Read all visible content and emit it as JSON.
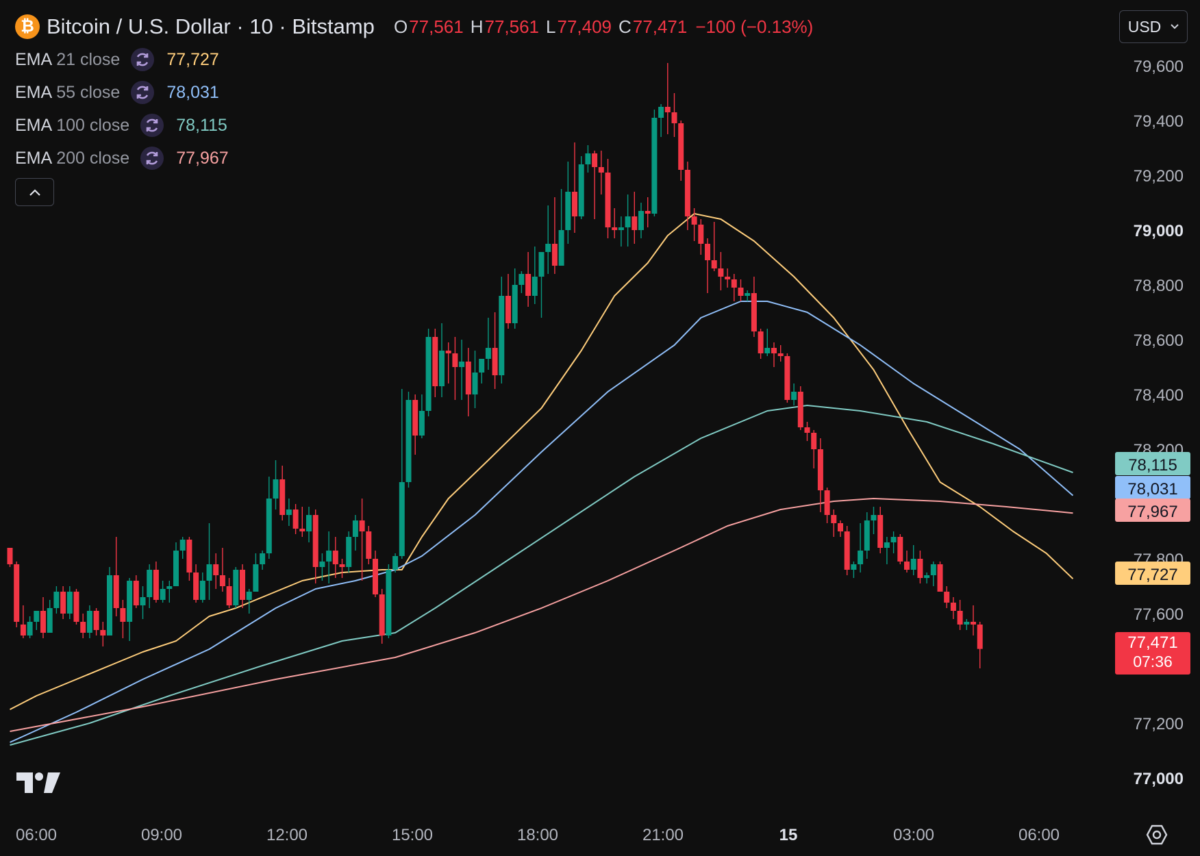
{
  "header": {
    "symbol_icon": "bitcoin-icon",
    "symbol_glyph": "₿",
    "title": "Bitcoin / U.S. Dollar · 10 · Bitstamp",
    "o_label": "O",
    "o_value": "77,561",
    "h_label": "H",
    "h_value": "77,561",
    "l_label": "L",
    "l_value": "77,409",
    "c_label": "C",
    "c_value": "77,471",
    "change": "−100 (−0.13%)",
    "currency": "USD"
  },
  "indicators": [
    {
      "name": "EMA",
      "params": "21 close",
      "value": "77,727",
      "color": "#ffce7c"
    },
    {
      "name": "EMA",
      "params": "55 close",
      "value": "78,031",
      "color": "#90bff9"
    },
    {
      "name": "EMA",
      "params": "100 close",
      "value": "78,115",
      "color": "#80cbc4"
    },
    {
      "name": "EMA",
      "params": "200 close",
      "value": "77,967",
      "color": "#f7a1a1"
    }
  ],
  "colors": {
    "up": "#089981",
    "down": "#f23645",
    "background": "#0f0f0f",
    "text": "#d1d4dc"
  },
  "chart_data": {
    "type": "candlestick",
    "ylim": [
      76940,
      79700
    ],
    "y_ticks": [
      {
        "v": 79600,
        "label": "79,600",
        "bold": false
      },
      {
        "v": 79400,
        "label": "79,400",
        "bold": false
      },
      {
        "v": 79200,
        "label": "79,200",
        "bold": false
      },
      {
        "v": 79000,
        "label": "79,000",
        "bold": true
      },
      {
        "v": 78800,
        "label": "78,800",
        "bold": false
      },
      {
        "v": 78600,
        "label": "78,600",
        "bold": false
      },
      {
        "v": 78400,
        "label": "78,400",
        "bold": false
      },
      {
        "v": 78200,
        "label": "78,200",
        "bold": false
      },
      {
        "v": 77800,
        "label": "77,800",
        "bold": false
      },
      {
        "v": 77600,
        "label": "77,600",
        "bold": false
      },
      {
        "v": 77200,
        "label": "77,200",
        "bold": false
      },
      {
        "v": 77000,
        "label": "77,000",
        "bold": true
      }
    ],
    "x_ticks": [
      {
        "label": "06:00",
        "bold": false
      },
      {
        "label": "09:00",
        "bold": false
      },
      {
        "label": "12:00",
        "bold": false
      },
      {
        "label": "15:00",
        "bold": false
      },
      {
        "label": "18:00",
        "bold": false
      },
      {
        "label": "21:00",
        "bold": false
      },
      {
        "label": "15",
        "bold": true
      },
      {
        "label": "03:00",
        "bold": false
      },
      {
        "label": "06:00",
        "bold": false
      }
    ],
    "candles": [
      [
        77840,
        77840,
        77770,
        77780
      ],
      [
        77780,
        77790,
        77550,
        77570
      ],
      [
        77560,
        77630,
        77510,
        77520
      ],
      [
        77520,
        77590,
        77510,
        77570
      ],
      [
        77570,
        77610,
        77540,
        77610
      ],
      [
        77610,
        77660,
        77510,
        77530
      ],
      [
        77530,
        77650,
        77530,
        77620
      ],
      [
        77620,
        77700,
        77600,
        77680
      ],
      [
        77680,
        77700,
        77580,
        77600
      ],
      [
        77600,
        77700,
        77580,
        77680
      ],
      [
        77680,
        77690,
        77560,
        77570
      ],
      [
        77570,
        77600,
        77510,
        77530
      ],
      [
        77530,
        77630,
        77510,
        77610
      ],
      [
        77610,
        77620,
        77520,
        77540
      ],
      [
        77540,
        77570,
        77480,
        77520
      ],
      [
        77520,
        77770,
        77520,
        77740
      ],
      [
        77740,
        77880,
        77590,
        77620
      ],
      [
        77620,
        77650,
        77510,
        77570
      ],
      [
        77570,
        77730,
        77500,
        77720
      ],
      [
        77720,
        77740,
        77620,
        77630
      ],
      [
        77630,
        77700,
        77580,
        77660
      ],
      [
        77660,
        77780,
        77620,
        77760
      ],
      [
        77760,
        77790,
        77640,
        77650
      ],
      [
        77650,
        77720,
        77640,
        77690
      ],
      [
        77690,
        77720,
        77640,
        77700
      ],
      [
        77700,
        77860,
        77700,
        77830
      ],
      [
        77830,
        77880,
        77800,
        77870
      ],
      [
        77870,
        77880,
        77720,
        77750
      ],
      [
        77750,
        77780,
        77640,
        77650
      ],
      [
        77650,
        77750,
        77640,
        77720
      ],
      [
        77720,
        77930,
        77650,
        77780
      ],
      [
        77780,
        77820,
        77690,
        77740
      ],
      [
        77740,
        77840,
        77680,
        77700
      ],
      [
        77700,
        77730,
        77620,
        77630
      ],
      [
        77630,
        77770,
        77620,
        77760
      ],
      [
        77760,
        77780,
        77620,
        77650
      ],
      [
        77650,
        77690,
        77600,
        77680
      ],
      [
        77680,
        77820,
        77680,
        77780
      ],
      [
        77780,
        77830,
        77760,
        77820
      ],
      [
        77820,
        78100,
        77800,
        78020
      ],
      [
        78020,
        78160,
        77980,
        78090
      ],
      [
        78090,
        78140,
        77940,
        77960
      ],
      [
        77960,
        78020,
        77920,
        77980
      ],
      [
        77980,
        78000,
        77890,
        77910
      ],
      [
        77910,
        77990,
        77880,
        77900
      ],
      [
        77900,
        77990,
        77860,
        77960
      ],
      [
        77960,
        77980,
        77710,
        77770
      ],
      [
        77770,
        77820,
        77720,
        77790
      ],
      [
        77790,
        77900,
        77710,
        77830
      ],
      [
        77830,
        77880,
        77730,
        77780
      ],
      [
        77780,
        77800,
        77730,
        77770
      ],
      [
        77770,
        77900,
        77750,
        77880
      ],
      [
        77880,
        77960,
        77830,
        77940
      ],
      [
        77940,
        78020,
        77720,
        77900
      ],
      [
        77900,
        77920,
        77780,
        77800
      ],
      [
        77800,
        77830,
        77660,
        77670
      ],
      [
        77670,
        77690,
        77490,
        77520
      ],
      [
        77520,
        77780,
        77510,
        77760
      ],
      [
        77760,
        77820,
        77750,
        77810
      ],
      [
        77810,
        78420,
        77800,
        78080
      ],
      [
        78080,
        78410,
        78060,
        78380
      ],
      [
        78380,
        78400,
        78180,
        78250
      ],
      [
        78250,
        78400,
        78240,
        78340
      ],
      [
        78340,
        78640,
        78320,
        78610
      ],
      [
        78610,
        78640,
        78390,
        78430
      ],
      [
        78430,
        78660,
        78390,
        78560
      ],
      [
        78560,
        78590,
        78440,
        78550
      ],
      [
        78550,
        78610,
        78380,
        78500
      ],
      [
        78500,
        78600,
        78380,
        78520
      ],
      [
        78520,
        78570,
        78320,
        78400
      ],
      [
        78400,
        78560,
        78350,
        78480
      ],
      [
        78480,
        78520,
        78440,
        78530
      ],
      [
        78530,
        78680,
        78490,
        78570
      ],
      [
        78570,
        78700,
        78420,
        78470
      ],
      [
        78470,
        78830,
        78440,
        78760
      ],
      [
        78760,
        78840,
        78640,
        78660
      ],
      [
        78660,
        78860,
        78640,
        78800
      ],
      [
        78800,
        78850,
        78770,
        78840
      ],
      [
        78840,
        78920,
        78720,
        78760
      ],
      [
        78760,
        78940,
        78730,
        78830
      ],
      [
        78830,
        78910,
        78680,
        78920
      ],
      [
        78920,
        79090,
        78840,
        78950
      ],
      [
        78950,
        79120,
        78840,
        78870
      ],
      [
        78870,
        79150,
        78870,
        79000
      ],
      [
        79000,
        79250,
        78950,
        79140
      ],
      [
        79140,
        79320,
        78990,
        79050
      ],
      [
        79050,
        79270,
        79040,
        79240
      ],
      [
        79240,
        79310,
        79210,
        79280
      ],
      [
        79280,
        79290,
        79040,
        79230
      ],
      [
        79230,
        79290,
        79130,
        79210
      ],
      [
        79210,
        79260,
        78970,
        79010
      ],
      [
        79010,
        79080,
        78970,
        79000
      ],
      [
        79000,
        79050,
        78940,
        79010
      ],
      [
        79010,
        79130,
        78940,
        79050
      ],
      [
        79050,
        79140,
        78950,
        79000
      ],
      [
        79000,
        79100,
        78970,
        79070
      ],
      [
        79070,
        79120,
        79010,
        79060
      ],
      [
        79060,
        79440,
        79050,
        79410
      ],
      [
        79410,
        79460,
        79340,
        79450
      ],
      [
        79450,
        79610,
        79350,
        79430
      ],
      [
        79430,
        79500,
        79340,
        79390
      ],
      [
        79390,
        79400,
        79180,
        79220
      ],
      [
        79220,
        79250,
        79000,
        79050
      ],
      [
        79050,
        79080,
        78960,
        79020
      ],
      [
        79020,
        79040,
        78910,
        78950
      ],
      [
        78950,
        78970,
        78770,
        78890
      ],
      [
        78890,
        79030,
        78850,
        78860
      ],
      [
        78860,
        78920,
        78780,
        78830
      ],
      [
        78830,
        78860,
        78790,
        78820
      ],
      [
        78820,
        78840,
        78740,
        78790
      ],
      [
        78790,
        78820,
        78740,
        78760
      ],
      [
        78760,
        78780,
        78740,
        78770
      ],
      [
        78770,
        78830,
        78610,
        78630
      ],
      [
        78630,
        78640,
        78530,
        78550
      ],
      [
        78550,
        78640,
        78540,
        78570
      ],
      [
        78570,
        78590,
        78500,
        78550
      ],
      [
        78550,
        78580,
        78520,
        78540
      ],
      [
        78540,
        78550,
        78370,
        78380
      ],
      [
        78380,
        78440,
        78360,
        78410
      ],
      [
        78410,
        78430,
        78270,
        78280
      ],
      [
        78280,
        78300,
        78230,
        78260
      ],
      [
        78260,
        78270,
        78130,
        78200
      ],
      [
        78200,
        78240,
        77970,
        78050
      ],
      [
        78050,
        78060,
        77930,
        77960
      ],
      [
        77960,
        77980,
        77880,
        77930
      ],
      [
        77930,
        77940,
        77880,
        77900
      ],
      [
        77900,
        77920,
        77740,
        77760
      ],
      [
        77760,
        77790,
        77730,
        77780
      ],
      [
        77780,
        77930,
        77750,
        77830
      ],
      [
        77830,
        77970,
        77800,
        77940
      ],
      [
        77940,
        77990,
        77890,
        77960
      ],
      [
        77960,
        77990,
        77820,
        77840
      ],
      [
        77840,
        77880,
        77780,
        77860
      ],
      [
        77860,
        77900,
        77820,
        77880
      ],
      [
        77880,
        77890,
        77780,
        77790
      ],
      [
        77790,
        77830,
        77750,
        77760
      ],
      [
        77760,
        77850,
        77740,
        77800
      ],
      [
        77800,
        77830,
        77710,
        77730
      ],
      [
        77730,
        77750,
        77710,
        77740
      ],
      [
        77740,
        77790,
        77700,
        77780
      ],
      [
        77780,
        77790,
        77680,
        77680
      ],
      [
        77680,
        77700,
        77620,
        77640
      ],
      [
        77640,
        77660,
        77580,
        77610
      ],
      [
        77610,
        77650,
        77540,
        77560
      ],
      [
        77560,
        77580,
        77540,
        77570
      ],
      [
        77570,
        77630,
        77520,
        77560
      ],
      [
        77560,
        77570,
        77400,
        77471
      ]
    ],
    "ema_series": [
      {
        "label_index": 0,
        "pts": [
          [
            0,
            77250
          ],
          [
            4,
            77300
          ],
          [
            10,
            77360
          ],
          [
            16,
            77420
          ],
          [
            20,
            77460
          ],
          [
            25,
            77500
          ],
          [
            30,
            77590
          ],
          [
            34,
            77620
          ],
          [
            38,
            77660
          ],
          [
            44,
            77720
          ],
          [
            50,
            77750
          ],
          [
            56,
            77760
          ],
          [
            59,
            77760
          ],
          [
            62,
            77880
          ],
          [
            66,
            78020
          ],
          [
            72,
            78160
          ],
          [
            80,
            78350
          ],
          [
            86,
            78560
          ],
          [
            91,
            78760
          ],
          [
            96,
            78880
          ],
          [
            99,
            78980
          ],
          [
            103,
            79060
          ],
          [
            107,
            79040
          ],
          [
            112,
            78960
          ],
          [
            118,
            78830
          ],
          [
            124,
            78680
          ],
          [
            130,
            78490
          ],
          [
            135,
            78280
          ],
          [
            140,
            78080
          ],
          [
            146,
            77990
          ],
          [
            151,
            77900
          ],
          [
            156,
            77820
          ],
          [
            160,
            77727
          ]
        ]
      },
      {
        "label_index": 1,
        "pts": [
          [
            0,
            77130
          ],
          [
            10,
            77240
          ],
          [
            20,
            77360
          ],
          [
            30,
            77470
          ],
          [
            40,
            77620
          ],
          [
            46,
            77690
          ],
          [
            52,
            77720
          ],
          [
            58,
            77760
          ],
          [
            62,
            77810
          ],
          [
            70,
            77960
          ],
          [
            80,
            78190
          ],
          [
            90,
            78410
          ],
          [
            100,
            78580
          ],
          [
            104,
            78680
          ],
          [
            110,
            78740
          ],
          [
            114,
            78740
          ],
          [
            120,
            78700
          ],
          [
            128,
            78580
          ],
          [
            136,
            78440
          ],
          [
            144,
            78320
          ],
          [
            152,
            78200
          ],
          [
            160,
            78031
          ]
        ]
      },
      {
        "label_index": 2,
        "pts": [
          [
            0,
            77120
          ],
          [
            12,
            77200
          ],
          [
            24,
            77300
          ],
          [
            38,
            77410
          ],
          [
            50,
            77500
          ],
          [
            58,
            77530
          ],
          [
            64,
            77620
          ],
          [
            74,
            77780
          ],
          [
            84,
            77940
          ],
          [
            94,
            78100
          ],
          [
            104,
            78240
          ],
          [
            114,
            78340
          ],
          [
            120,
            78360
          ],
          [
            128,
            78340
          ],
          [
            138,
            78300
          ],
          [
            148,
            78220
          ],
          [
            160,
            78115
          ]
        ]
      },
      {
        "label_index": 3,
        "pts": [
          [
            0,
            77170
          ],
          [
            20,
            77260
          ],
          [
            40,
            77360
          ],
          [
            58,
            77440
          ],
          [
            70,
            77530
          ],
          [
            80,
            77620
          ],
          [
            90,
            77720
          ],
          [
            100,
            77830
          ],
          [
            108,
            77920
          ],
          [
            116,
            77980
          ],
          [
            124,
            78010
          ],
          [
            130,
            78020
          ],
          [
            140,
            78010
          ],
          [
            150,
            77990
          ],
          [
            160,
            77967
          ]
        ]
      }
    ],
    "price_labels": [
      {
        "series": 2,
        "value": 78115,
        "text": "78,115",
        "bg": "#80cbc4"
      },
      {
        "series": 1,
        "value": 78031,
        "text": "78,031",
        "bg": "#90bff9"
      },
      {
        "series": 3,
        "value": 77967,
        "text": "77,967",
        "bg": "#f7a1a1"
      },
      {
        "series": 0,
        "value": 77727,
        "text": "77,727",
        "bg": "#ffce7c"
      }
    ],
    "last_price": {
      "value": 77471,
      "text": "77,471",
      "countdown": "07:36",
      "bg": "#f23645"
    }
  }
}
